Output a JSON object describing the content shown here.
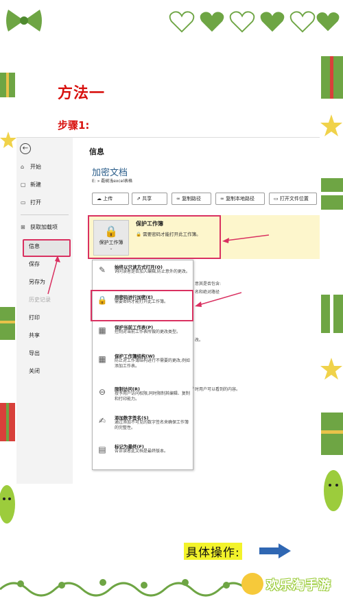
{
  "title": "方法一",
  "step_label": "步骤1:",
  "caption": "具体操作:",
  "watermark": "欢乐淘手游",
  "colors": {
    "accent_red": "#d8120f",
    "highlight_border": "#d93060",
    "heart_green": "#6ea544",
    "caption_bg": "#f3f32a",
    "arrow_blue": "#2f67b3"
  },
  "sidebar": {
    "back_icon": "back-arrow-icon",
    "items": [
      {
        "label": "开始",
        "icon": "home-icon"
      },
      {
        "label": "新建",
        "icon": "new-file-icon"
      },
      {
        "label": "打开",
        "icon": "folder-open-icon"
      },
      {
        "label": "获取加载项",
        "icon": "addin-icon"
      },
      {
        "label": "信息",
        "icon": ""
      },
      {
        "label": "保存",
        "icon": ""
      },
      {
        "label": "另存为",
        "icon": ""
      },
      {
        "label": "历史记录",
        "icon": ""
      },
      {
        "label": "打印",
        "icon": ""
      },
      {
        "label": "共享",
        "icon": ""
      },
      {
        "label": "导出",
        "icon": ""
      },
      {
        "label": "关闭",
        "icon": ""
      }
    ]
  },
  "main": {
    "heading": "信息",
    "doc_title": "加密文档",
    "path": "E: » 磊碗浅excel表格",
    "buttons": [
      "上传",
      "共享",
      "复制路径",
      "复制本地路径",
      "打开文件位置"
    ],
    "protect": {
      "button_label": "保护工作簿",
      "heading": "保护工作簿",
      "description": "需要密码才能打开此工作簿。"
    },
    "background_text": [
      "意其是否包含:",
      "名和绝对路径",
      "改。",
      "时用户可以看到的内容。"
    ],
    "menu": [
      {
        "title": "始终以只读方式打开(O)",
        "desc": "询问读者是否加入编辑,防止意外的更改。",
        "icon": "pen-icon"
      },
      {
        "title": "用密码进行加密(E)",
        "desc": "需要密码才能打开此工作簿。",
        "icon": "lock-icon"
      },
      {
        "title": "保护当前工作表(P)",
        "desc": "控制对当前工作表所做的更改类型。",
        "icon": "sheet-lock-icon"
      },
      {
        "title": "保护工作簿结构(W)",
        "desc": "防止对工作簿结构进行不需要的更改,例如添加工作表。",
        "icon": "workbook-structure-icon"
      },
      {
        "title": "限制访问(R)",
        "desc": "授予用户访问权限,同时限制其编辑、复制和打印能力。",
        "icon": "restrict-icon"
      },
      {
        "title": "添加数字签名(S)",
        "desc": "通过添加不可见的数字签名来确保工作簿的完整性。",
        "icon": "signature-icon"
      },
      {
        "title": "标记为最终(F)",
        "desc": "告诉读者此文档是最终版本。",
        "icon": "final-mark-icon"
      }
    ]
  }
}
